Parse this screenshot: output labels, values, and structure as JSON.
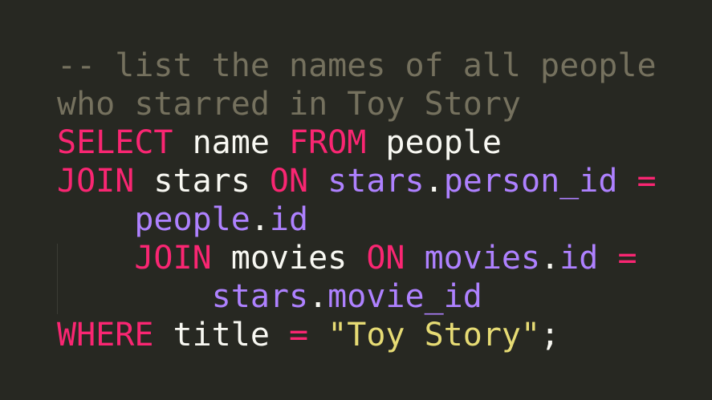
{
  "editor": {
    "theme_colors": {
      "background": "#272822",
      "comment": "#75715e",
      "keyword": "#f92672",
      "plain": "#f8f8f2",
      "identifier": "#ae81ff",
      "string": "#e6db74"
    },
    "lines": [
      [
        {
          "text": "-- list the names of all people",
          "type": "comment"
        }
      ],
      [
        {
          "text": "who starred in Toy Story",
          "type": "comment"
        }
      ],
      [
        {
          "text": "SELECT",
          "type": "keyword"
        },
        {
          "text": " name ",
          "type": "plain"
        },
        {
          "text": "FROM",
          "type": "keyword"
        },
        {
          "text": " people",
          "type": "plain"
        }
      ],
      [
        {
          "text": "JOIN",
          "type": "keyword"
        },
        {
          "text": " stars ",
          "type": "plain"
        },
        {
          "text": "ON",
          "type": "keyword"
        },
        {
          "text": " ",
          "type": "plain"
        },
        {
          "text": "stars",
          "type": "identifier"
        },
        {
          "text": ".",
          "type": "plain"
        },
        {
          "text": "person_id",
          "type": "identifier"
        },
        {
          "text": " ",
          "type": "plain"
        },
        {
          "text": "=",
          "type": "keyword"
        }
      ],
      [
        {
          "text": "    ",
          "type": "plain"
        },
        {
          "text": "people",
          "type": "identifier"
        },
        {
          "text": ".",
          "type": "plain"
        },
        {
          "text": "id",
          "type": "identifier"
        }
      ],
      [
        {
          "text": "    ",
          "type": "plain"
        },
        {
          "text": "JOIN",
          "type": "keyword"
        },
        {
          "text": " movies ",
          "type": "plain"
        },
        {
          "text": "ON",
          "type": "keyword"
        },
        {
          "text": " ",
          "type": "plain"
        },
        {
          "text": "movies",
          "type": "identifier"
        },
        {
          "text": ".",
          "type": "plain"
        },
        {
          "text": "id",
          "type": "identifier"
        },
        {
          "text": " ",
          "type": "plain"
        },
        {
          "text": "=",
          "type": "keyword"
        }
      ],
      [
        {
          "text": "        ",
          "type": "plain"
        },
        {
          "text": "stars",
          "type": "identifier"
        },
        {
          "text": ".",
          "type": "plain"
        },
        {
          "text": "movie_id",
          "type": "identifier"
        }
      ],
      [
        {
          "text": "WHERE",
          "type": "keyword"
        },
        {
          "text": " title ",
          "type": "plain"
        },
        {
          "text": "=",
          "type": "keyword"
        },
        {
          "text": " ",
          "type": "plain"
        },
        {
          "text": "\"Toy Story\"",
          "type": "string"
        },
        {
          "text": ";",
          "type": "plain"
        }
      ]
    ]
  }
}
